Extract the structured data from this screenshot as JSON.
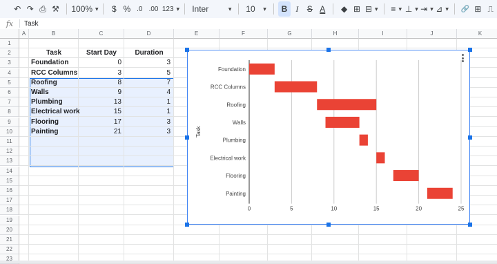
{
  "toolbar": {
    "undo_glyph": "↶",
    "redo_glyph": "↷",
    "print_glyph": "⎙",
    "paint_format_glyph": "⚒",
    "zoom": "100%",
    "currency": "$",
    "percent": "%",
    "decrease_decimal": ".0",
    "increase_decimal": ".00",
    "more_formats": "123",
    "font": "Inter",
    "font_size": "10",
    "bold": "B",
    "italic": "I",
    "strikethrough": "S",
    "text_color": "A",
    "fill_glyph": "◆",
    "borders_glyph": "⊞",
    "merge_glyph": "⊟",
    "align_glyph": "≡",
    "valign_glyph": "⊥",
    "wrap_glyph": "⇥",
    "rotate_glyph": "⊿",
    "link_glyph": "🔗",
    "comment_glyph": "⊞",
    "chart_glyph": "⎍",
    "dropdown_glyph": "▾",
    "accent_color": "#d93025"
  },
  "formula_bar": {
    "fx": "fx",
    "value": "Task"
  },
  "sheet": {
    "columns": [
      "A",
      "B",
      "C",
      "D",
      "E",
      "F",
      "G",
      "H",
      "I",
      "J",
      "K"
    ],
    "rows": [
      "1",
      "2",
      "3",
      "4",
      "5",
      "6",
      "7",
      "8",
      "9",
      "10",
      "11",
      "12",
      "13",
      "14",
      "15",
      "16",
      "17",
      "18",
      "19",
      "20",
      "21",
      "22",
      "23"
    ],
    "headers": [
      "Task",
      "Start Day",
      "Duration"
    ],
    "data": [
      {
        "task": "Foundation",
        "start": "0",
        "duration": "3"
      },
      {
        "task": "RCC Columns",
        "start": "3",
        "duration": "5"
      },
      {
        "task": "Roofing",
        "start": "8",
        "duration": "7"
      },
      {
        "task": "Walls",
        "start": "9",
        "duration": "4"
      },
      {
        "task": "Plumbing",
        "start": "13",
        "duration": "1"
      },
      {
        "task": "Electrical work",
        "start": "15",
        "duration": "1"
      },
      {
        "task": "Flooring",
        "start": "17",
        "duration": "3"
      },
      {
        "task": "Painting",
        "start": "21",
        "duration": "3"
      }
    ]
  },
  "chart_data": {
    "type": "bar",
    "orientation": "horizontal",
    "title": "",
    "xlabel": "",
    "ylabel": "Task",
    "categories": [
      "Foundation",
      "RCC Columns",
      "Roofing",
      "Walls",
      "Plumbing",
      "Electrical work",
      "Flooring",
      "Painting"
    ],
    "start": [
      0,
      3,
      8,
      9,
      13,
      15,
      17,
      21
    ],
    "duration": [
      3,
      5,
      7,
      4,
      1,
      1,
      3,
      3
    ],
    "xlim": [
      0,
      25
    ],
    "xticks": [
      "0",
      "5",
      "10",
      "15",
      "20",
      "25"
    ],
    "grid": true,
    "legend": "none",
    "bar_color": "#ea4335"
  }
}
